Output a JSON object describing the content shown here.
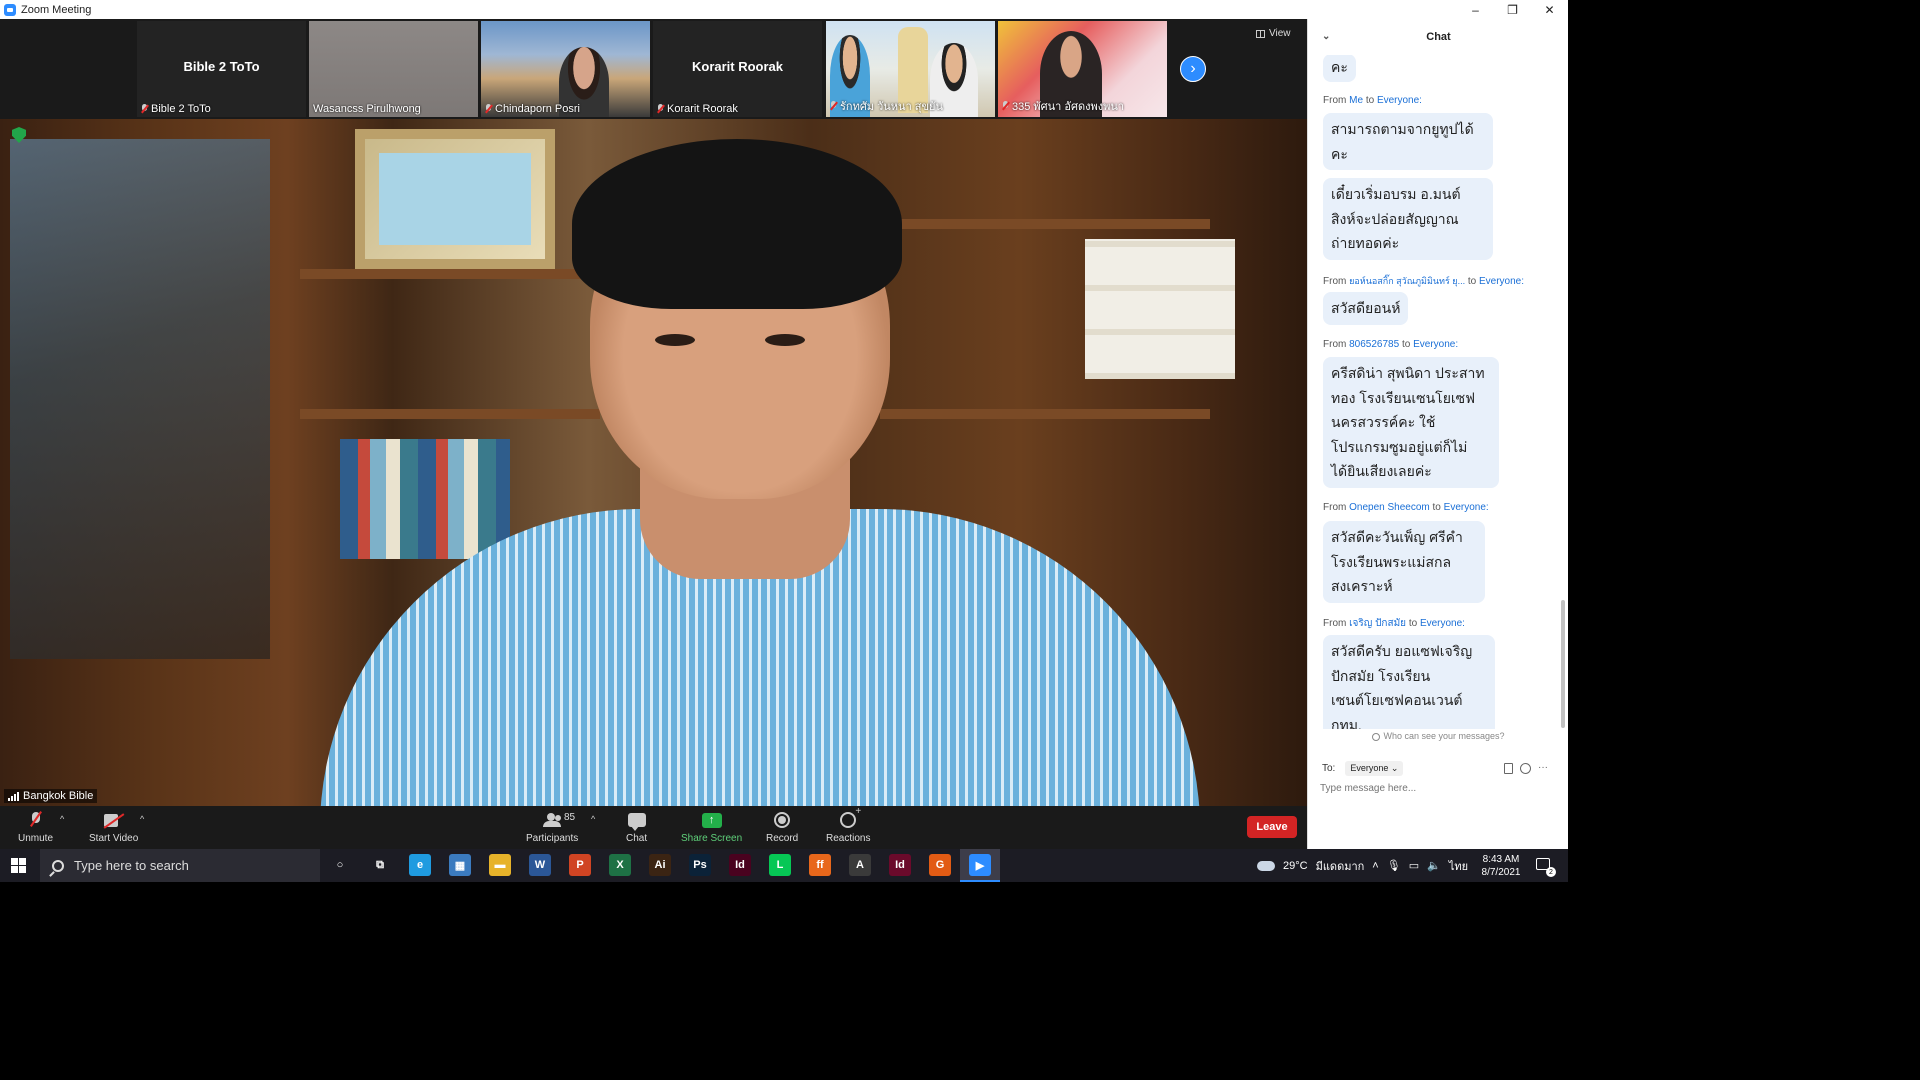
{
  "window": {
    "title": "Zoom Meeting",
    "controls": {
      "minimize": "–",
      "restore": "❐",
      "close": "✕"
    }
  },
  "thumbnails": [
    {
      "display_name": "Bible 2 ToTo",
      "label": "Bible 2 ToTo",
      "video": false
    },
    {
      "display_name": "",
      "label": "Wasancss Pirulhwong",
      "video": true
    },
    {
      "display_name": "",
      "label": "Chindaporn Posri",
      "video": true
    },
    {
      "display_name": "Korarit Roorak",
      "label": "Korarit Roorak",
      "video": false
    },
    {
      "display_name": "",
      "label": "รักทศัม วันหนา สุขยัน",
      "video": true
    },
    {
      "display_name": "",
      "label": "335 พัศนา อัศดงพงพนา",
      "video": true
    }
  ],
  "view_button": "View",
  "next_icon": "›",
  "main_video": {
    "speaker_label": "Bangkok Bible"
  },
  "toolbar": {
    "unmute": "Unmute",
    "start_video": "Start Video",
    "participants": "Participants",
    "participant_count": "85",
    "chat": "Chat",
    "share_screen": "Share Screen",
    "record": "Record",
    "reactions": "Reactions",
    "leave": "Leave",
    "caret": "^"
  },
  "chat": {
    "title": "Chat",
    "collapse_icon": "⌄",
    "messages": [
      {
        "from": "",
        "to": "",
        "text": "คะ"
      },
      {
        "from": "Me",
        "to": "Everyone:",
        "text": "สามารถตามจากยูทูปได้คะ"
      },
      {
        "from": "",
        "to": "",
        "text": "เดี๋ยวเริ่มอบรม อ.มนต์สิงห์จะปล่อยสัญญาณถ่ายทอดค่ะ"
      },
      {
        "from": "ยอห์นอสกิ๊ก สุวัณภูมิมินทร์ ยุ...",
        "to": "Everyone:",
        "text": "สวัสดียอนห์"
      },
      {
        "from": "806526785",
        "to": "Everyone:",
        "text": "ครีสดิน่า สุพนิดา ประสาททอง โรงเรียนเซนโยเซฟนครสวรรค์คะ ใช้โปรแกรมซูมอยู่แต่ก็ไม่ได้ยินเสียงเลยค่ะ"
      },
      {
        "from": "Onepen Sheecom",
        "to": "Everyone:",
        "text": "สวัสดีคะวันเพ็ญ  ศรีคำโรงเรียนพระแม่สกลสงเคราะห์"
      },
      {
        "from": "เจริญ ปักสมัย",
        "to": "Everyone:",
        "text": "สวัสดีครับ ยอแซฟเจริญ ปักสมัย โรงเรียนเซนต์โยเซฟคอนเวนต์ กทม."
      }
    ],
    "from_word": "From",
    "to_word": "to",
    "privacy": "Who can see your messages?",
    "to_label": "To:",
    "to_value": "Everyone ⌄",
    "input_placeholder": "Type message here..."
  },
  "taskbar": {
    "search_placeholder": "Type here to search",
    "weather": "29°C",
    "weather_text": "มีแดดมาก",
    "lang": "ไทย",
    "time": "8:43 AM",
    "date": "8/7/2021",
    "notify_count": "2",
    "apps": [
      {
        "name": "cortana-icon",
        "glyph": "○",
        "color": "transparent"
      },
      {
        "name": "task-view-icon",
        "glyph": "⧉",
        "color": "transparent"
      },
      {
        "name": "edge-icon",
        "glyph": "e",
        "color": "#1f9be0"
      },
      {
        "name": "calculator-icon",
        "glyph": "▦",
        "color": "#3b7bbf"
      },
      {
        "name": "file-explorer-icon",
        "glyph": "▬",
        "color": "#e7b32a"
      },
      {
        "name": "word-icon",
        "glyph": "W",
        "color": "#2b5797"
      },
      {
        "name": "powerpoint-icon",
        "glyph": "P",
        "color": "#d04423"
      },
      {
        "name": "excel-icon",
        "glyph": "X",
        "color": "#1e7145"
      },
      {
        "name": "illustrator-icon",
        "glyph": "Ai",
        "color": "#3b2413"
      },
      {
        "name": "photoshop-icon",
        "glyph": "Ps",
        "color": "#0b2238"
      },
      {
        "name": "indesign-icon",
        "glyph": "Id",
        "color": "#49021f"
      },
      {
        "name": "line-icon",
        "glyph": "L",
        "color": "#06c755"
      },
      {
        "name": "firefox-icon",
        "glyph": "ff",
        "color": "#e8671b"
      },
      {
        "name": "acrobat-icon",
        "glyph": "A",
        "color": "#3a3a3a"
      },
      {
        "name": "indesign-2-icon",
        "glyph": "Id",
        "color": "#6b0a2b"
      },
      {
        "name": "g-app-icon",
        "glyph": "G",
        "color": "#e25b14"
      },
      {
        "name": "zoom-app-icon",
        "glyph": "▶",
        "color": "#2d8cff"
      }
    ]
  }
}
